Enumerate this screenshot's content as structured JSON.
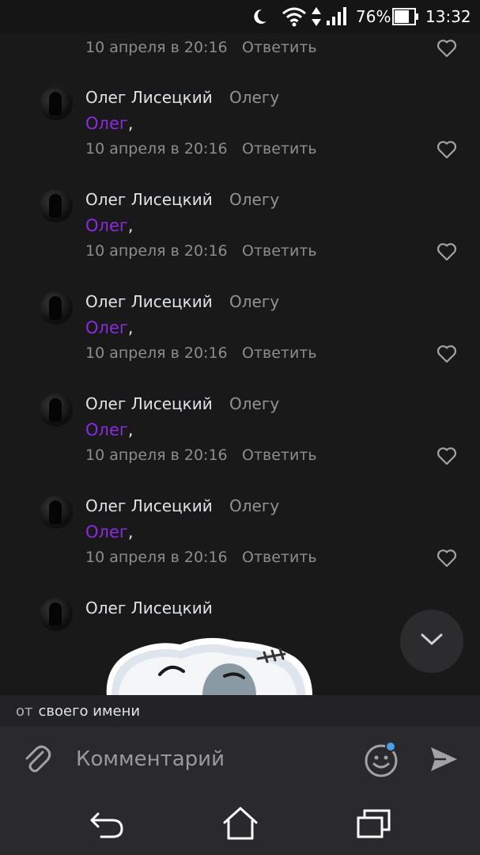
{
  "status_bar": {
    "battery": "76%",
    "time": "13:32"
  },
  "top_partial": {
    "date": "10 апреля в 20:16",
    "reply_label": "Ответить"
  },
  "comments": [
    {
      "author": "Олег Лисецкий",
      "reply_to": "Олегу",
      "mention": "Олег",
      "punct": ",",
      "date": "10 апреля в 20:16",
      "reply_label": "Ответить"
    },
    {
      "author": "Олег Лисецкий",
      "reply_to": "Олегу",
      "mention": "Олег",
      "punct": ",",
      "date": "10 апреля в 20:16",
      "reply_label": "Ответить"
    },
    {
      "author": "Олег Лисецкий",
      "reply_to": "Олегу",
      "mention": "Олег",
      "punct": ",",
      "date": "10 апреля в 20:16",
      "reply_label": "Ответить"
    },
    {
      "author": "Олег Лисецкий",
      "reply_to": "Олегу",
      "mention": "Олег",
      "punct": ",",
      "date": "10 апреля в 20:16",
      "reply_label": "Ответить"
    },
    {
      "author": "Олег Лисецкий",
      "reply_to": "Олегу",
      "mention": "Олег",
      "punct": ",",
      "date": "10 апреля в 20:16",
      "reply_label": "Ответить"
    }
  ],
  "last_comment": {
    "author": "Олег Лисецкий"
  },
  "from_bar": {
    "prefix": "от",
    "name": "своего имени"
  },
  "composer": {
    "placeholder": "Комментарий"
  },
  "colors": {
    "background": "#19191a",
    "mention": "#8a2be2",
    "secondary_text": "#8d8d8f",
    "composer_bg": "#2a2a2c",
    "emoji_badge": "#4a9fe8"
  },
  "icons": {
    "attach": "paperclip-icon",
    "emoji": "smile-icon",
    "send": "send-icon",
    "like": "heart-icon",
    "scroll": "chevron-down-icon",
    "back": "back-icon",
    "home": "home-icon",
    "recents": "recents-icon"
  }
}
